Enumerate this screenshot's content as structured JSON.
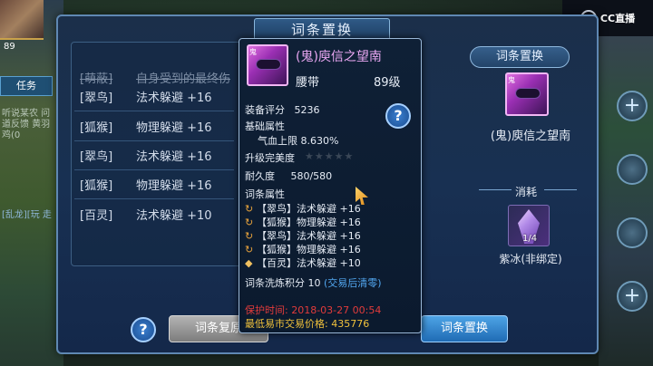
{
  "dialog": {
    "title": "词条置换"
  },
  "affix_list": [
    {
      "tag": "[翠鸟]",
      "attr": "法术躲避 +16"
    },
    {
      "tag": "[狐猴]",
      "attr": "物理躲避 +16"
    },
    {
      "tag": "[翠鸟]",
      "attr": "法术躲避 +16"
    },
    {
      "tag": "[狐猴]",
      "attr": "物理躲避 +16"
    },
    {
      "tag": "[百灵]",
      "attr": "法术躲避 +10"
    }
  ],
  "struck_row": {
    "tag": "[萌蔽]",
    "text": "自身受到的最终伤"
  },
  "tooltip": {
    "name": "(鬼)庾信之望南",
    "type": "腰带",
    "level": "89级",
    "score_label": "装备评分",
    "score_value": "5236",
    "base_attr_label": "基础属性",
    "base_attr_value": "气血上限 8.630%",
    "perfect_label": "升级完美度",
    "durability_label": "耐久度",
    "durability_value": "580/580",
    "affix_label": "词条属性",
    "affixes": [
      "【翠鸟】法术躲避 +16",
      "【狐猴】物理躲避 +16",
      "【翠鸟】法术躲避 +16",
      "【狐猴】物理躲避 +16",
      "【百灵】法术躲避 +10"
    ],
    "wash_score": "词条洗炼积分 10",
    "wash_note": "(交易后清零)",
    "protect_time": "保护时间: 2018-03-27 00:54",
    "min_price": "最低易市交易价格: 435776",
    "help_label": "?"
  },
  "right_panel": {
    "title": "词条置换",
    "item_name": "(鬼)庾信之望南",
    "consume_label": "消耗",
    "consume_item": "紫冰(非绑定)",
    "consume_count": "1/4"
  },
  "buttons": {
    "help": "?",
    "restore": "词条复原",
    "replace": "词条置换"
  },
  "hud": {
    "level": "89",
    "tab_task": "任务",
    "quest_text": "听说某农  问道反馈  黄羽鸡(0",
    "bottom_text": "[乱龙][玩  走"
  }
}
